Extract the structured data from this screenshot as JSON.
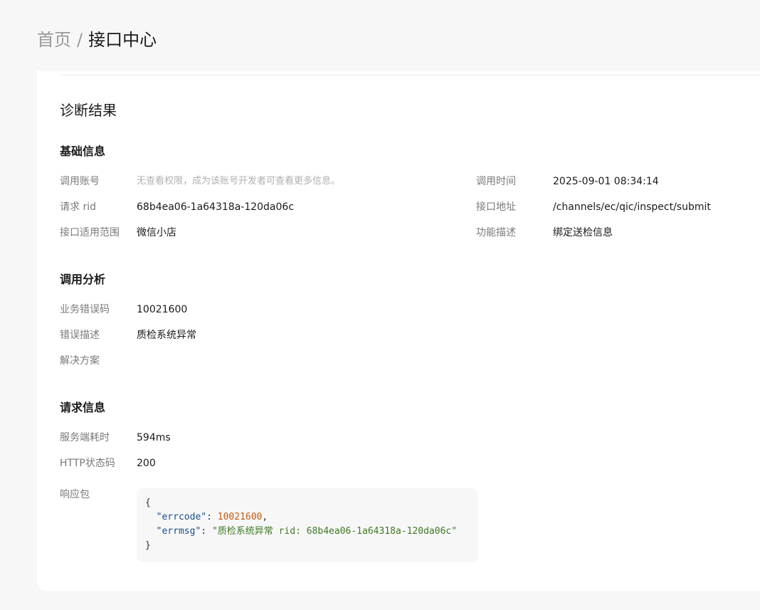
{
  "breadcrumb": {
    "home": "首页",
    "separator": "/",
    "current": "接口中心"
  },
  "page": {
    "title": "诊断结果"
  },
  "basic_info": {
    "title": "基础信息",
    "account_label": "调用账号",
    "account_value": "无查看权限，成为该账号开发者可查看更多信息。",
    "time_label": "调用时间",
    "time_value": "2025-09-01 08:34:14",
    "rid_label": "请求 rid",
    "rid_value": "68b4ea06-1a64318a-120da06c",
    "path_label": "接口地址",
    "path_value": "/channels/ec/qic/inspect/submit",
    "scope_label": "接口适用范围",
    "scope_value": "微信小店",
    "desc_label": "功能描述",
    "desc_value": "绑定送检信息"
  },
  "call_analysis": {
    "title": "调用分析",
    "errcode_label": "业务错误码",
    "errcode_value": "10021600",
    "errdesc_label": "错误描述",
    "errdesc_value": "质检系统异常",
    "solution_label": "解决方案",
    "solution_value": ""
  },
  "request_info": {
    "title": "请求信息",
    "latency_label": "服务端耗时",
    "latency_value": "594ms",
    "http_label": "HTTP状态码",
    "http_value": "200",
    "response_label": "响应包",
    "response": {
      "open_brace": "{",
      "errcode_key": "\"errcode\"",
      "errcode_val": "10021600",
      "errmsg_key": "\"errmsg\"",
      "errmsg_val": "\"质检系统异常 rid: 68b4ea06-1a64318a-120da06c\"",
      "close_brace": "}"
    }
  },
  "colors": {
    "background": "#f7f7f7",
    "card": "#ffffff",
    "label": "#7a7a7a",
    "code_key": "#1b4f8a",
    "code_number": "#c25a12",
    "code_string": "#3f7a24"
  }
}
